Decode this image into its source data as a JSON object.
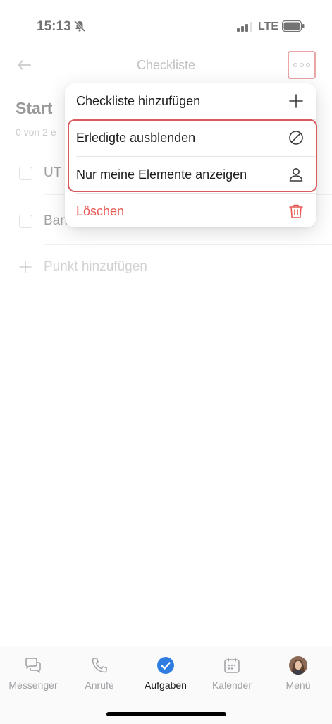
{
  "status": {
    "time": "15:13",
    "network": "LTE"
  },
  "nav": {
    "title": "Checkliste"
  },
  "list": {
    "title": "Start",
    "subtitle": "0 von 2 e",
    "items": [
      {
        "label": "UT"
      },
      {
        "label": "Ban"
      }
    ],
    "add_label": "Punkt hinzufügen"
  },
  "menu": {
    "items": [
      {
        "label": "Checkliste hinzufügen",
        "icon": "plus-icon"
      },
      {
        "label": "Erledigte ausblenden",
        "icon": "hide-completed-icon"
      },
      {
        "label": "Nur meine Elemente anzeigen",
        "icon": "person-icon"
      },
      {
        "label": "Löschen",
        "icon": "trash-icon"
      }
    ]
  },
  "tabs": [
    {
      "label": "Messenger",
      "icon": "chat-icon"
    },
    {
      "label": "Anrufe",
      "icon": "phone-icon"
    },
    {
      "label": "Aufgaben",
      "icon": "tasks-check-icon",
      "active": true
    },
    {
      "label": "Kalender",
      "icon": "calendar-icon"
    },
    {
      "label": "Menü",
      "icon": "avatar-icon"
    }
  ],
  "colors": {
    "accent": "#2f7de1",
    "danger": "#e85a54",
    "highlight": "#d95c5c"
  }
}
